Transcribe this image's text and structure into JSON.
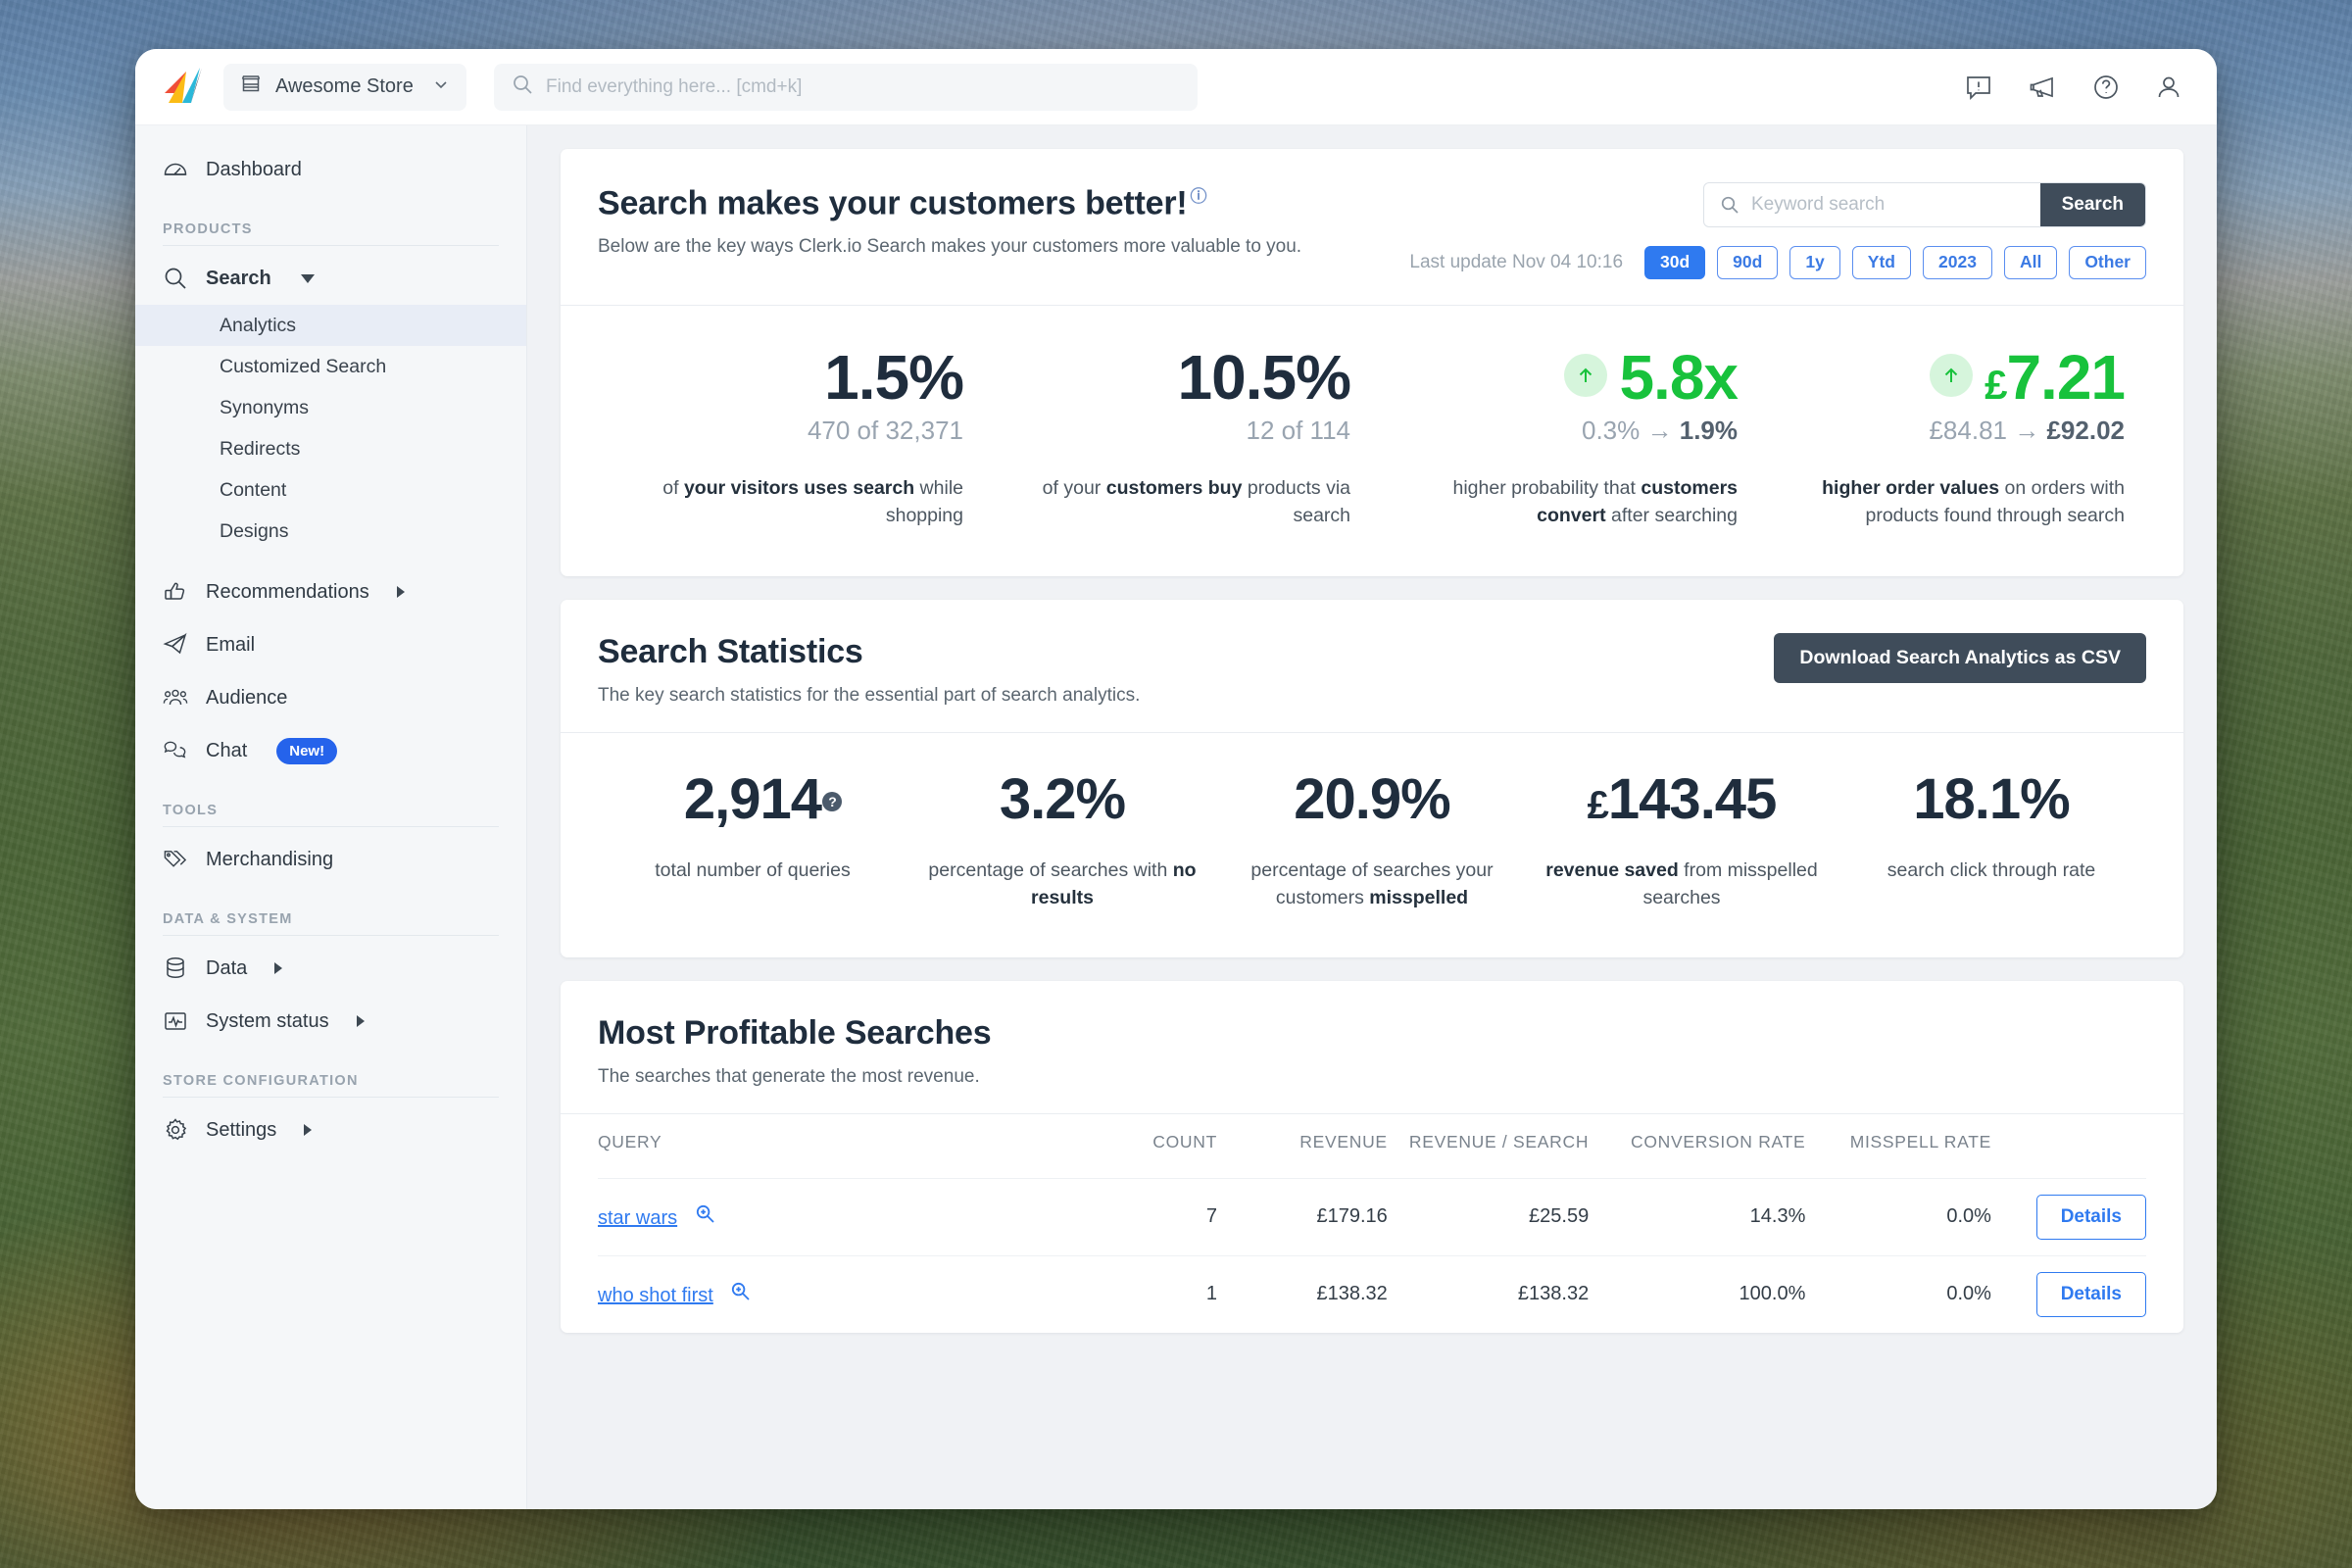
{
  "topbar": {
    "store_name": "Awesome Store",
    "store_icon": "store-icon",
    "chevron_icon": "chevron-down-icon",
    "search_placeholder": "Find everything here... [cmd+k]",
    "search_value": "",
    "icons": [
      "feedback-icon",
      "megaphone-icon",
      "help-circle-icon",
      "user-account-icon"
    ]
  },
  "sidebar": {
    "dashboard": {
      "label": "Dashboard",
      "icon": "gauge-icon"
    },
    "sections": [
      {
        "heading": "PRODUCTS",
        "items": [
          {
            "label": "Search",
            "icon": "search-icon",
            "bold": true,
            "caret": "down",
            "children": [
              {
                "label": "Analytics",
                "active": true
              },
              {
                "label": "Customized Search",
                "active": false
              },
              {
                "label": "Synonyms",
                "active": false
              },
              {
                "label": "Redirects",
                "active": false
              },
              {
                "label": "Content",
                "active": false
              },
              {
                "label": "Designs",
                "active": false
              }
            ]
          },
          {
            "label": "Recommendations",
            "icon": "thumbs-up-icon",
            "caret": "right"
          },
          {
            "label": "Email",
            "icon": "paper-plane-icon"
          },
          {
            "label": "Audience",
            "icon": "people-icon"
          },
          {
            "label": "Chat",
            "icon": "chat-bubbles-icon",
            "badge": "New!"
          }
        ]
      },
      {
        "heading": "TOOLS",
        "items": [
          {
            "label": "Merchandising",
            "icon": "tags-icon"
          }
        ]
      },
      {
        "heading": "DATA & SYSTEM",
        "items": [
          {
            "label": "Data",
            "icon": "database-icon",
            "caret": "right"
          },
          {
            "label": "System status",
            "icon": "pulse-icon",
            "caret": "right"
          }
        ]
      },
      {
        "heading": "STORE CONFIGURATION",
        "items": [
          {
            "label": "Settings",
            "icon": "gear-icon",
            "caret": "right"
          }
        ]
      }
    ]
  },
  "hero": {
    "title": "Search makes your customers better!",
    "title_help": "?",
    "subtitle": "Below are the key ways Clerk.io Search makes your customers more valuable to you.",
    "keyword_placeholder": "Keyword search",
    "keyword_value": "",
    "search_button": "Search",
    "last_update": "Last update Nov 04 10:16",
    "ranges": [
      {
        "label": "30d",
        "active": true
      },
      {
        "label": "90d",
        "active": false
      },
      {
        "label": "1y",
        "active": false
      },
      {
        "label": "Ytd",
        "active": false
      },
      {
        "label": "2023",
        "active": false
      },
      {
        "label": "All",
        "active": false
      },
      {
        "label": "Other",
        "active": false
      }
    ],
    "kpis": [
      {
        "value": "1.5%",
        "sub": "470 of 32,371",
        "desc_pre": "of ",
        "desc_bold": "your visitors uses search",
        "desc_post": " while shopping",
        "green": false,
        "arrow": false
      },
      {
        "value": "10.5%",
        "sub": "12 of 114",
        "desc_pre": "of ",
        "desc_bold": "customers buy",
        "desc_post": " products via search",
        "desc_pre2": "your ",
        "green": false,
        "arrow": false
      },
      {
        "value": "5.8x",
        "sub_from": "0.3%",
        "sub_arrow": "→",
        "sub_to": "1.9%",
        "desc_pre": "higher probability that ",
        "desc_bold": "customers convert",
        "desc_post": " after searching",
        "green": true,
        "arrow": true
      },
      {
        "value": "7.21",
        "currency": "£",
        "sub_from": "£84.81",
        "sub_arrow": "→",
        "sub_to": "£92.02",
        "desc_bold": "higher order values",
        "desc_post": " on orders with products found through search",
        "green": true,
        "arrow": true
      }
    ]
  },
  "stats": {
    "title": "Search Statistics",
    "subtitle": "The key search statistics for the essential part of search analytics.",
    "download_label": "Download Search Analytics as CSV",
    "items": [
      {
        "value": "2,914",
        "currency": "",
        "desc_pre": "total number of queries",
        "desc_bold": "",
        "desc_post": "",
        "help": true
      },
      {
        "value": "3.2%",
        "currency": "",
        "desc_pre": "percentage of searches with ",
        "desc_bold": "no results",
        "desc_post": "",
        "help": false
      },
      {
        "value": "20.9%",
        "currency": "",
        "desc_pre": "percentage of searches your customers ",
        "desc_bold": "misspelled",
        "desc_post": "",
        "help": false
      },
      {
        "value": "143.45",
        "currency": "£",
        "desc_pre": "",
        "desc_bold": "revenue saved",
        "desc_post": " from misspelled searches",
        "help": false
      },
      {
        "value": "18.1%",
        "currency": "",
        "desc_pre": "search click through rate",
        "desc_bold": "",
        "desc_post": "",
        "help": false
      }
    ]
  },
  "profitable": {
    "title": "Most Profitable Searches",
    "subtitle": "The searches that generate the most revenue.",
    "columns": [
      "QUERY",
      "COUNT",
      "REVENUE",
      "REVENUE / SEARCH",
      "CONVERSION RATE",
      "MISSPELL RATE",
      ""
    ],
    "details_label": "Details",
    "zoom_icon": "magnifier-plus-icon",
    "rows": [
      {
        "query": "star wars",
        "count": "7",
        "revenue": "£179.16",
        "revenue_per_search": "£25.59",
        "conversion_rate": "14.3%",
        "misspell_rate": "0.0%"
      },
      {
        "query": "who shot first",
        "count": "1",
        "revenue": "£138.32",
        "revenue_per_search": "£138.32",
        "conversion_rate": "100.0%",
        "misspell_rate": "0.0%"
      }
    ]
  },
  "colors": {
    "accent_blue": "#2f7af0",
    "green": "#18c23c",
    "dark_button": "#3f4c5a",
    "text_dark": "#1f2d3d"
  }
}
